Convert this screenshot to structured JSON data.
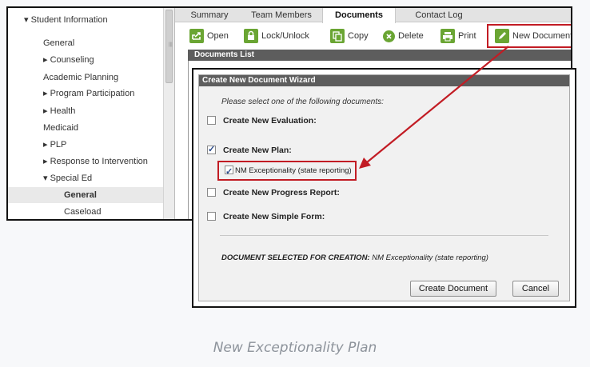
{
  "sidebar": {
    "items": [
      {
        "label": "▾ Student Information",
        "level": 0
      },
      {
        "label": "General",
        "level": 1
      },
      {
        "label": "▸ Counseling",
        "level": 1
      },
      {
        "label": "Academic Planning",
        "level": 1
      },
      {
        "label": "▸ Program Participation",
        "level": 1
      },
      {
        "label": "▸ Health",
        "level": 1
      },
      {
        "label": "Medicaid",
        "level": 1
      },
      {
        "label": "▸ PLP",
        "level": 1
      },
      {
        "label": "▸ Response to Intervention",
        "level": 1
      },
      {
        "label": "▾ Special Ed",
        "level": 1
      },
      {
        "label": "General",
        "level": 2,
        "selected": true
      },
      {
        "label": "Caseload",
        "level": 2
      }
    ]
  },
  "tabs": [
    {
      "label": "Summary"
    },
    {
      "label": "Team Members"
    },
    {
      "label": "Documents",
      "active": true
    },
    {
      "label": "Contact Log"
    }
  ],
  "toolbar": {
    "open": "Open",
    "lock": "Lock/Unlock",
    "copy": "Copy",
    "delete": "Delete",
    "print": "Print",
    "new_document": "New Document"
  },
  "documents_list_title": "Documents List",
  "wizard": {
    "title": "Create New Document Wizard",
    "prompt": "Please select one of the following documents:",
    "options": [
      {
        "label": "Create New Evaluation:",
        "checked": false
      },
      {
        "label": "Create New Plan:",
        "checked": true
      },
      {
        "label": "Create New Progress Report:",
        "checked": false
      },
      {
        "label": "Create New Simple Form:",
        "checked": false
      }
    ],
    "sub_option": {
      "label": "NM Exceptionality (state reporting)",
      "checked": true
    },
    "selected_prefix": "DOCUMENT SELECTED FOR CREATION:",
    "selected_value": "NM Exceptionality (state reporting)",
    "create_button": "Create Document",
    "cancel_button": "Cancel"
  },
  "caption": "New Exceptionality Plan",
  "colors": {
    "accent_green": "#6aa533",
    "highlight_red": "#c21c24",
    "header_gray": "#5d5d5d"
  }
}
